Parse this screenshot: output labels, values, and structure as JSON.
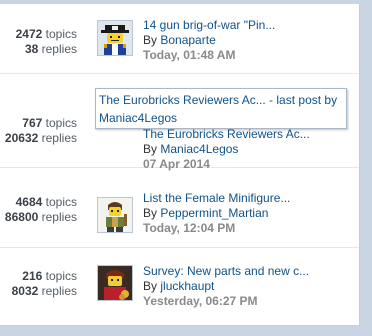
{
  "forum_rows": [
    {
      "topics_count": "2472",
      "topics_label": "topics",
      "replies_count": "38",
      "replies_label": "replies",
      "avatar_icon": "pirate-minifig-icon",
      "last_post_title": "14 gun brig-of-war \"Pin...",
      "by_label": "By",
      "author": "Bonaparte",
      "timestamp": "Today, 01:48 AM"
    },
    {
      "topics_count": "767",
      "topics_label": "topics",
      "replies_count": "20632",
      "replies_label": "replies",
      "avatar_icon": "",
      "last_post_title": "The Eurobricks Reviewers Ac...",
      "by_label": "By",
      "author": "Maniac4Legos",
      "timestamp": "07 Apr 2014"
    },
    {
      "topics_count": "4684",
      "topics_label": "topics",
      "replies_count": "86800",
      "replies_label": "replies",
      "avatar_icon": "minifig-avatar-icon",
      "last_post_title": "List the Female Minifigure...",
      "by_label": "By",
      "author": "Peppermint_Martian",
      "timestamp": "Today, 12:04 PM"
    },
    {
      "topics_count": "216",
      "topics_label": "topics",
      "replies_count": "8032",
      "replies_label": "replies",
      "avatar_icon": "minifig-photo-avatar-icon",
      "last_post_title": "Survey: New parts and new c...",
      "by_label": "By",
      "author": "jluckhaupt",
      "timestamp": "Yesterday, 06:27 PM"
    }
  ],
  "tooltip": {
    "text": "The Eurobricks Reviewers Ac... - last post by Maniac4Legos"
  },
  "colors": {
    "link": "#105289",
    "timestamp": "#8a8a8a",
    "background": "#c9d5e3"
  }
}
